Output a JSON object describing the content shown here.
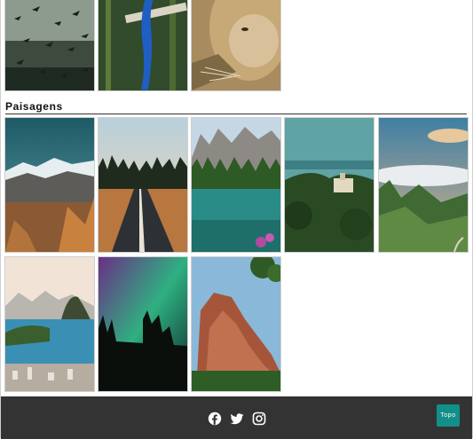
{
  "sections": {
    "landscapes_title": "Paisagens"
  },
  "gallery": {
    "animals": [
      "birds-flock-photo",
      "blue-macaw-photo",
      "lion-photo"
    ],
    "landscapes": [
      "snowy-mountains-photo",
      "forest-road-photo",
      "alpine-lake-photo",
      "coastal-town-photo",
      "cloudy-mountains-photo",
      "rio-bay-photo",
      "aurora-forest-photo",
      "red-rock-cliff-photo"
    ]
  },
  "footer": {
    "social_icons": [
      "facebook-icon",
      "twitter-icon",
      "instagram-icon"
    ],
    "top_button_label": "Topo",
    "background": "#333333",
    "accent": "#138f8a"
  }
}
